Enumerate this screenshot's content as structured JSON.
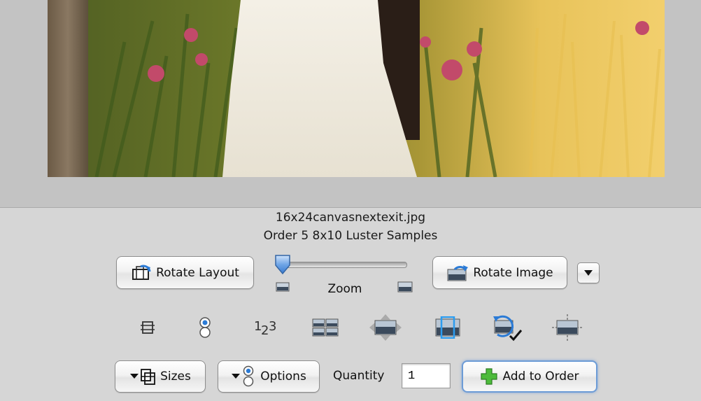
{
  "photo": {
    "alt": "Wedding photo of bride in white dress among pink lilies and golden grass"
  },
  "info": {
    "filename": "16x24canvasnextexit.jpg",
    "order": "Order 5 8x10 Luster Samples"
  },
  "toolbar": {
    "rotate_layout_label": "Rotate Layout",
    "rotate_image_label": "Rotate Image",
    "zoom_label": "Zoom",
    "zoom_value": 0.0
  },
  "tools": [
    {
      "name": "crop-frame-icon"
    },
    {
      "name": "options-indicator-icon"
    },
    {
      "name": "numbering-icon",
      "text": "1₂3"
    },
    {
      "name": "multi-image-layout-icon"
    },
    {
      "name": "move-image-icon"
    },
    {
      "name": "fit-image-icon"
    },
    {
      "name": "rotate-check-icon"
    },
    {
      "name": "center-image-icon"
    }
  ],
  "bottom": {
    "sizes_label": "Sizes",
    "options_label": "Options",
    "quantity_label": "Quantity",
    "quantity_value": "1",
    "add_label": "Add to Order"
  },
  "colors": {
    "accent_focus": "#6c9bd6",
    "add_icon_green": "#4dbb3b"
  }
}
